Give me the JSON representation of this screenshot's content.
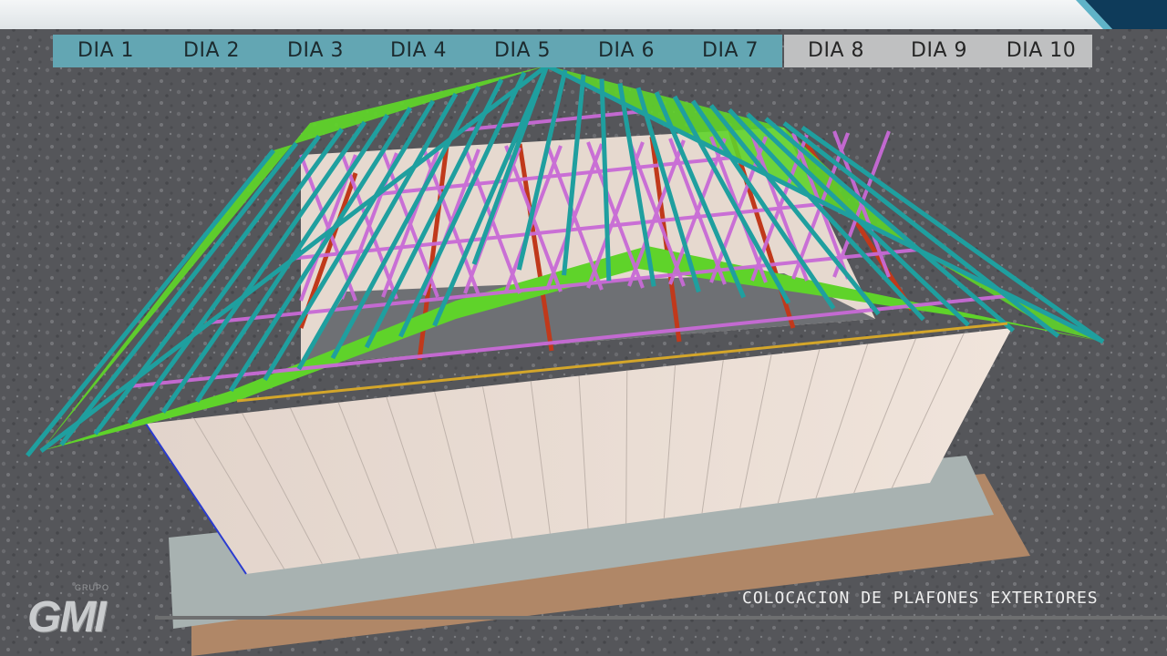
{
  "tabs": [
    {
      "label": "DIA 1",
      "state": "done"
    },
    {
      "label": "DIA 2",
      "state": "done"
    },
    {
      "label": "DIA 3",
      "state": "done"
    },
    {
      "label": "DIA 4",
      "state": "done"
    },
    {
      "label": "DIA 5",
      "state": "done"
    },
    {
      "label": "DIA 6",
      "state": "done"
    },
    {
      "label": "DIA 7",
      "state": "done"
    },
    {
      "label": "DIA 8",
      "state": "pending"
    },
    {
      "label": "DIA 9",
      "state": "pending"
    },
    {
      "label": "DIA 10",
      "state": "pending"
    }
  ],
  "caption": "COLOCACION DE PLAFONES EXTERIORES",
  "logo": {
    "text": "GMI",
    "tagline": "GRUPO"
  },
  "colors": {
    "tab_active": "#63a6b3",
    "tab_pending": "#bfc0c1",
    "ground": "#5a5b5e",
    "roof_panel": "#5fd32a",
    "purlin": "#1f9f9f",
    "truss": "#c86ad6",
    "beam": "#c0391b",
    "wall": "#e9dcd3"
  }
}
